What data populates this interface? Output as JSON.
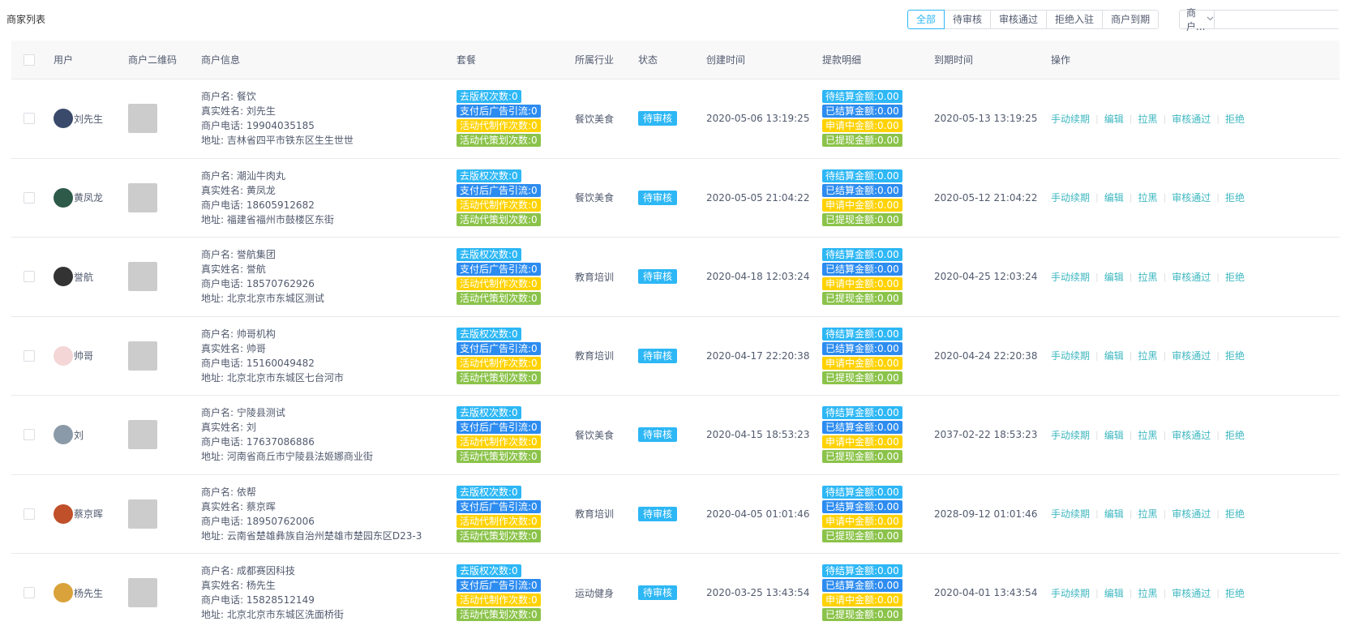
{
  "page": {
    "title": "商家列表"
  },
  "filters": [
    {
      "label": "全部",
      "active": true
    },
    {
      "label": "待审核",
      "active": false
    },
    {
      "label": "审核通过",
      "active": false
    },
    {
      "label": "拒绝入驻",
      "active": false
    },
    {
      "label": "商户到期",
      "active": false
    }
  ],
  "search": {
    "select_value": "商户...",
    "placeholder": ""
  },
  "columns": {
    "user": "用户",
    "qr": "商户二维码",
    "info": "商户信息",
    "package": "套餐",
    "industry": "所属行业",
    "status": "状态",
    "created": "创建时间",
    "withdraw": "提款明细",
    "expire": "到期时间",
    "ops": "操作"
  },
  "operations": [
    "手动续期",
    "编辑",
    "拉黑",
    "审核通过",
    "拒绝"
  ],
  "rows": [
    {
      "user": "刘先生",
      "avatar_color": "#3a4a6a",
      "info": [
        "商户名: 餐饮",
        "真实姓名: 刘先生",
        "商户电话: 19904035185",
        "地址: 吉林省四平市铁东区生生世世"
      ],
      "package": [
        "去版权次数:0",
        "支付后广告引流:0",
        "活动代制作次数:0",
        "活动代策划次数:0"
      ],
      "industry": "餐饮美食",
      "status": "待审核",
      "created": "2020-05-06 13:19:25",
      "withdraw": [
        "待结算金额:0.00",
        "已结算金额:0.00",
        "申请中金额:0.00",
        "已提现金额:0.00"
      ],
      "expire": "2020-05-13 13:19:25"
    },
    {
      "user": "黄凤龙",
      "avatar_color": "#2e5a4a",
      "info": [
        "商户名: 潮汕牛肉丸",
        "真实姓名: 黄凤龙",
        "商户电话: 18605912682",
        "地址: 福建省福州市鼓楼区东街"
      ],
      "package": [
        "去版权次数:0",
        "支付后广告引流:0",
        "活动代制作次数:0",
        "活动代策划次数:0"
      ],
      "industry": "餐饮美食",
      "status": "待审核",
      "created": "2020-05-05 21:04:22",
      "withdraw": [
        "待结算金额:0.00",
        "已结算金额:0.00",
        "申请中金额:0.00",
        "已提现金额:0.00"
      ],
      "expire": "2020-05-12 21:04:22"
    },
    {
      "user": "誉航",
      "avatar_color": "#333333",
      "info": [
        "商户名: 誉航集团",
        "真实姓名: 誉航",
        "商户电话: 18570762926",
        "地址: 北京北京市东城区测试"
      ],
      "package": [
        "去版权次数:0",
        "支付后广告引流:0",
        "活动代制作次数:0",
        "活动代策划次数:0"
      ],
      "industry": "教育培训",
      "status": "待审核",
      "created": "2020-04-18 12:03:24",
      "withdraw": [
        "待结算金额:0.00",
        "已结算金额:0.00",
        "申请中金额:0.00",
        "已提现金额:0.00"
      ],
      "expire": "2020-04-25 12:03:24"
    },
    {
      "user": "帅哥",
      "avatar_color": "#f4d6d6",
      "info": [
        "商户名: 帅哥机构",
        "真实姓名: 帅哥",
        "商户电话: 15160049482",
        "地址: 北京北京市东城区七台河市"
      ],
      "package": [
        "去版权次数:0",
        "支付后广告引流:0",
        "活动代制作次数:0",
        "活动代策划次数:0"
      ],
      "industry": "教育培训",
      "status": "待审核",
      "created": "2020-04-17 22:20:38",
      "withdraw": [
        "待结算金额:0.00",
        "已结算金额:0.00",
        "申请中金额:0.00",
        "已提现金额:0.00"
      ],
      "expire": "2020-04-24 22:20:38"
    },
    {
      "user": "刘",
      "avatar_color": "#8a9aa8",
      "info": [
        "商户名: 宁陵县测试",
        "真实姓名: 刘",
        "商户电话: 17637086886",
        "地址: 河南省商丘市宁陵县法姬娜商业街"
      ],
      "package": [
        "去版权次数:0",
        "支付后广告引流:0",
        "活动代制作次数:0",
        "活动代策划次数:0"
      ],
      "industry": "餐饮美食",
      "status": "待审核",
      "created": "2020-04-15 18:53:23",
      "withdraw": [
        "待结算金额:0.00",
        "已结算金额:0.00",
        "申请中金额:0.00",
        "已提现金额:0.00"
      ],
      "expire": "2037-02-22 18:53:23"
    },
    {
      "user": "蔡京晖",
      "avatar_color": "#c0502a",
      "info": [
        "商户名: 依帮",
        "真实姓名: 蔡京晖",
        "商户电话: 18950762006",
        "地址: 云南省楚雄彝族自治州楚雄市楚园东区D23-3"
      ],
      "package": [
        "去版权次数:0",
        "支付后广告引流:0",
        "活动代制作次数:0",
        "活动代策划次数:0"
      ],
      "industry": "教育培训",
      "status": "待审核",
      "created": "2020-04-05 01:01:46",
      "withdraw": [
        "待结算金额:0.00",
        "已结算金额:0.00",
        "申请中金额:0.00",
        "已提现金额:0.00"
      ],
      "expire": "2028-09-12 01:01:46"
    },
    {
      "user": "杨先生",
      "avatar_color": "#d9a23a",
      "info": [
        "商户名: 成都赛因科技",
        "真实姓名: 杨先生",
        "商户电话: 15828512149",
        "地址: 北京北京市东城区洗面桥街"
      ],
      "package": [
        "去版权次数:0",
        "支付后广告引流:0",
        "活动代制作次数:0",
        "活动代策划次数:0"
      ],
      "industry": "运动健身",
      "status": "待审核",
      "created": "2020-03-25 13:43:54",
      "withdraw": [
        "待结算金额:0.00",
        "已结算金额:0.00",
        "申请中金额:0.00",
        "已提现金额:0.00"
      ],
      "expire": "2020-04-01 13:43:54"
    }
  ]
}
